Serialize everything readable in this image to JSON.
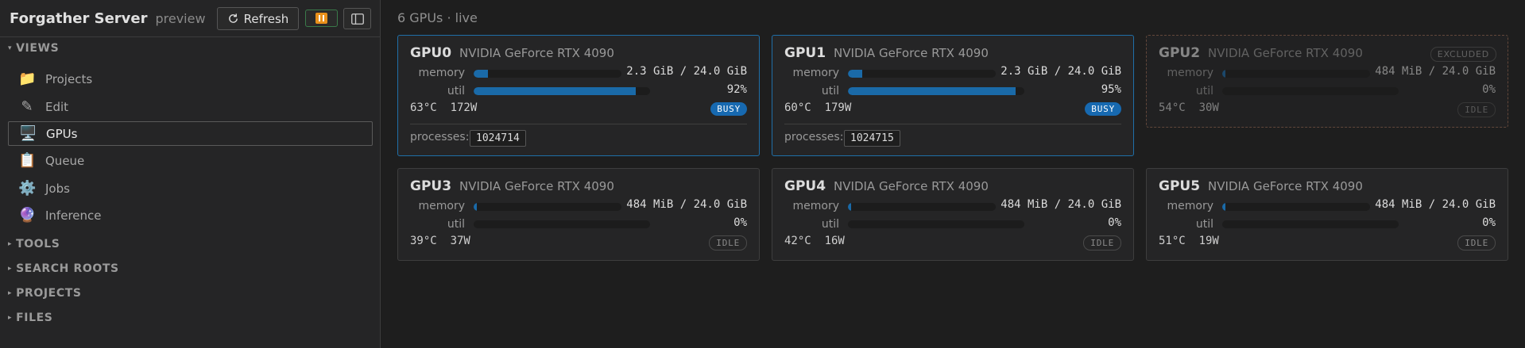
{
  "header": {
    "title": "Forgather Server",
    "subtitle": "preview",
    "refresh_label": "Refresh"
  },
  "sections": {
    "views": "VIEWS",
    "tools": "TOOLS",
    "search_roots": "SEARCH ROOTS",
    "projects": "PROJECTS",
    "files": "FILES"
  },
  "nav": [
    {
      "label": "Projects",
      "icon": "folder-icon",
      "glyph": "📁"
    },
    {
      "label": "Edit",
      "icon": "pencil-icon",
      "glyph": "✎"
    },
    {
      "label": "GPUs",
      "icon": "desktop-computer-icon",
      "glyph": "🖥️"
    },
    {
      "label": "Queue",
      "icon": "clipboard-icon",
      "glyph": "📋"
    },
    {
      "label": "Jobs",
      "icon": "gear-icon",
      "glyph": "⚙️"
    },
    {
      "label": "Inference",
      "icon": "crystal-ball-icon",
      "glyph": "🔮"
    }
  ],
  "main": {
    "title": "6 GPUs · live",
    "memory_label": "memory",
    "util_label": "util",
    "processes_label": "processes:",
    "excluded_label": "EXCLUDED"
  },
  "gpus": [
    {
      "id": "GPU0",
      "name": "NVIDIA GeForce RTX 4090",
      "memory": "2.3 GiB / 24.0 GiB",
      "mem_frac": 0.096,
      "util": "92%",
      "util_frac": 0.92,
      "temp": "63°C",
      "power": "172W",
      "state": "BUSY",
      "processes": [
        "1024714"
      ]
    },
    {
      "id": "GPU1",
      "name": "NVIDIA GeForce RTX 4090",
      "memory": "2.3 GiB / 24.0 GiB",
      "mem_frac": 0.096,
      "util": "95%",
      "util_frac": 0.95,
      "temp": "60°C",
      "power": "179W",
      "state": "BUSY",
      "processes": [
        "1024715"
      ]
    },
    {
      "id": "GPU2",
      "name": "NVIDIA GeForce RTX 4090",
      "memory": "484 MiB / 24.0 GiB",
      "mem_frac": 0.02,
      "util": "0%",
      "util_frac": 0,
      "temp": "54°C",
      "power": "30W",
      "state": "IDLE",
      "excluded": true
    },
    {
      "id": "GPU3",
      "name": "NVIDIA GeForce RTX 4090",
      "memory": "484 MiB / 24.0 GiB",
      "mem_frac": 0.02,
      "util": "0%",
      "util_frac": 0,
      "temp": "39°C",
      "power": "37W",
      "state": "IDLE"
    },
    {
      "id": "GPU4",
      "name": "NVIDIA GeForce RTX 4090",
      "memory": "484 MiB / 24.0 GiB",
      "mem_frac": 0.02,
      "util": "0%",
      "util_frac": 0,
      "temp": "42°C",
      "power": "16W",
      "state": "IDLE"
    },
    {
      "id": "GPU5",
      "name": "NVIDIA GeForce RTX 4090",
      "memory": "484 MiB / 24.0 GiB",
      "mem_frac": 0.02,
      "util": "0%",
      "util_frac": 0,
      "temp": "51°C",
      "power": "19W",
      "state": "IDLE"
    }
  ],
  "colors": {
    "accent": "#1a6aa8",
    "busy_badge": "#1769b0",
    "excluded_border": "#9a6a52",
    "pause": "#e8901a"
  }
}
